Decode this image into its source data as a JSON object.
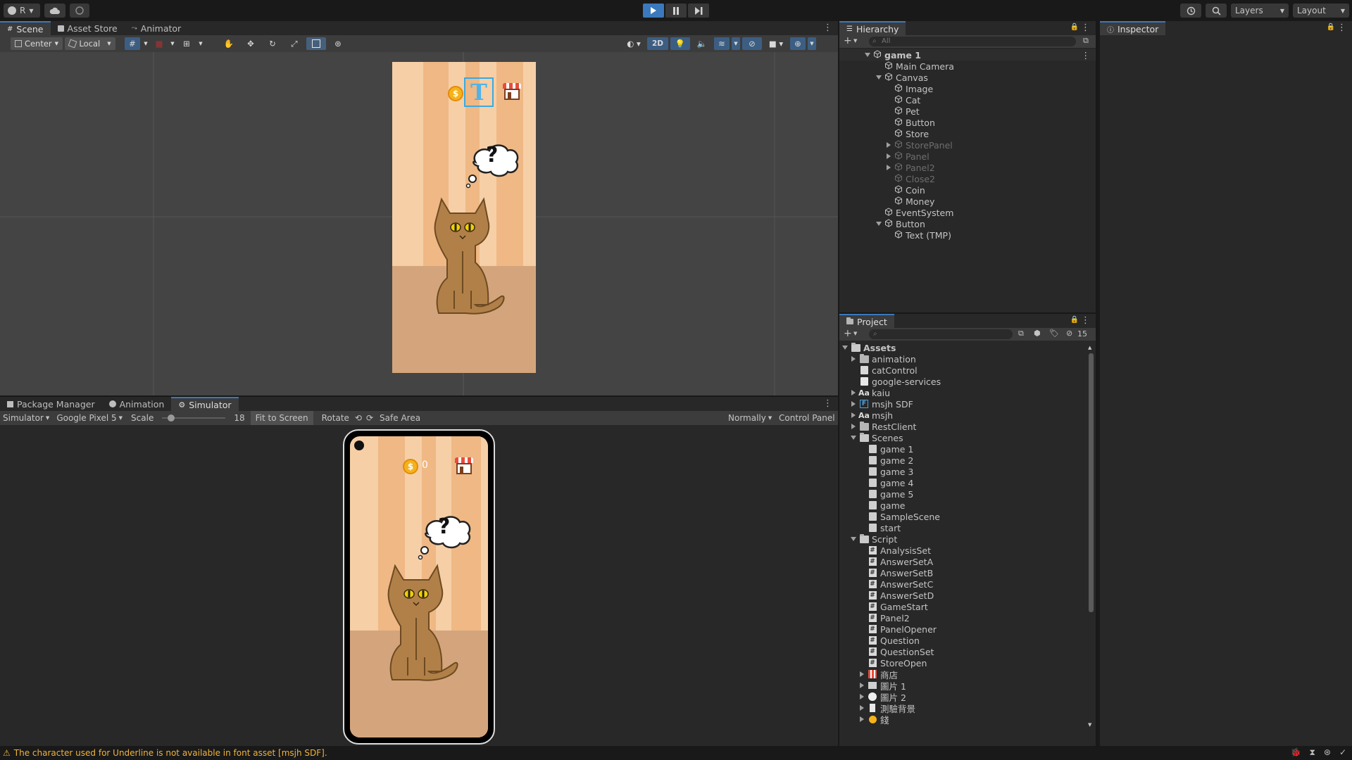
{
  "toolbar": {
    "account_label": "R",
    "layers_label": "Layers",
    "layout_label": "Layout"
  },
  "scene_panel": {
    "tabs": [
      "Scene",
      "Asset Store",
      "Animator"
    ],
    "pivot_label": "Center",
    "space_label": "Local",
    "mode_2d": "2D"
  },
  "bottom_panel": {
    "tabs": [
      "Package Manager",
      "Animation",
      "Simulator"
    ],
    "view_dropdown": "Simulator",
    "device_dropdown": "Google Pixel 5",
    "scale_label": "Scale",
    "scale_value": "18",
    "scale_fraction": 0.1,
    "fit_label": "Fit to Screen",
    "rotate_label": "Rotate",
    "safe_area_label": "Safe Area",
    "normally_dropdown": "Normally",
    "control_panel_label": "Control Panel"
  },
  "game": {
    "coin_count": "0",
    "question_mark": "?",
    "text_gizmo": "T"
  },
  "hierarchy": {
    "title": "Hierarchy",
    "search_placeholder": "All",
    "items": [
      {
        "label": "game 1",
        "level": 0,
        "arrow": "down",
        "bold": true,
        "dim": false
      },
      {
        "label": "Main Camera",
        "level": 1,
        "arrow": "",
        "bold": false,
        "dim": false
      },
      {
        "label": "Canvas",
        "level": 1,
        "arrow": "down",
        "bold": false,
        "dim": false
      },
      {
        "label": "Image",
        "level": 2,
        "arrow": "",
        "bold": false,
        "dim": false
      },
      {
        "label": "Cat",
        "level": 2,
        "arrow": "",
        "bold": false,
        "dim": false
      },
      {
        "label": "Pet",
        "level": 2,
        "arrow": "",
        "bold": false,
        "dim": false
      },
      {
        "label": "Button",
        "level": 2,
        "arrow": "",
        "bold": false,
        "dim": false
      },
      {
        "label": "Store",
        "level": 2,
        "arrow": "",
        "bold": false,
        "dim": false
      },
      {
        "label": "StorePanel",
        "level": 2,
        "arrow": "right",
        "bold": false,
        "dim": true
      },
      {
        "label": "Panel",
        "level": 2,
        "arrow": "right",
        "bold": false,
        "dim": true
      },
      {
        "label": "Panel2",
        "level": 2,
        "arrow": "right",
        "bold": false,
        "dim": true
      },
      {
        "label": "Close2",
        "level": 2,
        "arrow": "",
        "bold": false,
        "dim": true
      },
      {
        "label": "Coin",
        "level": 2,
        "arrow": "",
        "bold": false,
        "dim": false
      },
      {
        "label": "Money",
        "level": 2,
        "arrow": "",
        "bold": false,
        "dim": false
      },
      {
        "label": "EventSystem",
        "level": 1,
        "arrow": "",
        "bold": false,
        "dim": false
      },
      {
        "label": "Button",
        "level": 1,
        "arrow": "down",
        "bold": false,
        "dim": false
      },
      {
        "label": "Text (TMP)",
        "level": 2,
        "arrow": "",
        "bold": false,
        "dim": false
      }
    ]
  },
  "inspector": {
    "title": "Inspector"
  },
  "project": {
    "title": "Project",
    "hidden_count": "15",
    "items": [
      {
        "label": "Assets",
        "level": 0,
        "arrow": "down",
        "icon": "folder-open",
        "bold": true
      },
      {
        "label": "animation",
        "level": 1,
        "arrow": "right",
        "icon": "folder",
        "bold": false
      },
      {
        "label": "catControl",
        "level": 1,
        "arrow": "",
        "icon": "controller",
        "bold": false
      },
      {
        "label": "google-services",
        "level": 1,
        "arrow": "",
        "icon": "file",
        "bold": false
      },
      {
        "label": "kaiu",
        "level": 1,
        "arrow": "right",
        "icon": "font",
        "bold": false
      },
      {
        "label": "msjh SDF",
        "level": 1,
        "arrow": "right",
        "icon": "sdf",
        "bold": false
      },
      {
        "label": "msjh",
        "level": 1,
        "arrow": "right",
        "icon": "font",
        "bold": false
      },
      {
        "label": "RestClient",
        "level": 1,
        "arrow": "right",
        "icon": "folder",
        "bold": false
      },
      {
        "label": "Scenes",
        "level": 1,
        "arrow": "down",
        "icon": "folder-open",
        "bold": false
      },
      {
        "label": "game 1",
        "level": 2,
        "arrow": "",
        "icon": "scene",
        "bold": false
      },
      {
        "label": "game 2",
        "level": 2,
        "arrow": "",
        "icon": "scene",
        "bold": false
      },
      {
        "label": "game 3",
        "level": 2,
        "arrow": "",
        "icon": "scene",
        "bold": false
      },
      {
        "label": "game 4",
        "level": 2,
        "arrow": "",
        "icon": "scene",
        "bold": false
      },
      {
        "label": "game 5",
        "level": 2,
        "arrow": "",
        "icon": "scene",
        "bold": false
      },
      {
        "label": "game",
        "level": 2,
        "arrow": "",
        "icon": "scene",
        "bold": false
      },
      {
        "label": "SampleScene",
        "level": 2,
        "arrow": "",
        "icon": "scene",
        "bold": false
      },
      {
        "label": "start",
        "level": 2,
        "arrow": "",
        "icon": "scene",
        "bold": false
      },
      {
        "label": "Script",
        "level": 1,
        "arrow": "down",
        "icon": "folder-open",
        "bold": false
      },
      {
        "label": "AnalysisSet",
        "level": 2,
        "arrow": "",
        "icon": "script",
        "bold": false
      },
      {
        "label": "AnswerSetA",
        "level": 2,
        "arrow": "",
        "icon": "script",
        "bold": false
      },
      {
        "label": "AnswerSetB",
        "level": 2,
        "arrow": "",
        "icon": "script",
        "bold": false
      },
      {
        "label": "AnswerSetC",
        "level": 2,
        "arrow": "",
        "icon": "script",
        "bold": false
      },
      {
        "label": "AnswerSetD",
        "level": 2,
        "arrow": "",
        "icon": "script",
        "bold": false
      },
      {
        "label": "GameStart",
        "level": 2,
        "arrow": "",
        "icon": "script",
        "bold": false
      },
      {
        "label": "Panel2",
        "level": 2,
        "arrow": "",
        "icon": "script",
        "bold": false
      },
      {
        "label": "PanelOpener",
        "level": 2,
        "arrow": "",
        "icon": "script",
        "bold": false
      },
      {
        "label": "Question",
        "level": 2,
        "arrow": "",
        "icon": "script",
        "bold": false
      },
      {
        "label": "QuestionSet",
        "level": 2,
        "arrow": "",
        "icon": "script",
        "bold": false
      },
      {
        "label": "StoreOpen",
        "level": 2,
        "arrow": "",
        "icon": "script",
        "bold": false
      },
      {
        "label": "商店",
        "level": 2,
        "arrow": "right",
        "icon": "sprite-store",
        "bold": false
      },
      {
        "label": "圖片 1",
        "level": 2,
        "arrow": "right",
        "icon": "sprite-img",
        "bold": false
      },
      {
        "label": "圖片 2",
        "level": 2,
        "arrow": "right",
        "icon": "sprite-img2",
        "bold": false
      },
      {
        "label": "測驗背景",
        "level": 2,
        "arrow": "right",
        "icon": "sprite-bg",
        "bold": false
      },
      {
        "label": "錢",
        "level": 2,
        "arrow": "right",
        "icon": "sprite-coin",
        "bold": false
      }
    ]
  },
  "status": {
    "message": "The character used for Underline is not available in font asset [msjh SDF]."
  }
}
